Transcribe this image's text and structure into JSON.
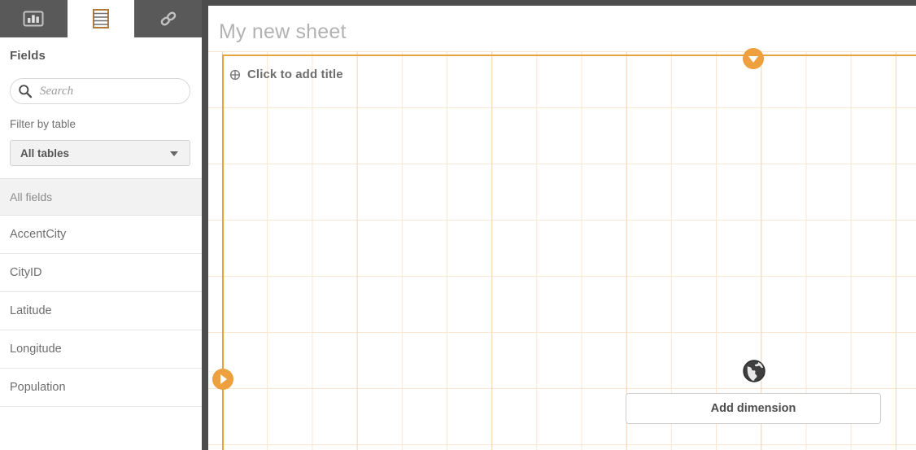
{
  "app": {
    "accent_color": "#ee9f3e",
    "grid_line_color": "#fbe6d0",
    "dark_bar_color": "#4d4d4d"
  },
  "sidebar": {
    "tabs": [
      {
        "name": "charts-tab",
        "icon": "bar-chart-icon",
        "active": false
      },
      {
        "name": "fields-tab",
        "icon": "table-icon",
        "active": true
      },
      {
        "name": "links-tab",
        "icon": "link-icon",
        "active": false
      }
    ],
    "panel_title": "Fields",
    "search": {
      "placeholder": "Search",
      "value": "",
      "icon": "search-icon"
    },
    "filter": {
      "label": "Filter by table",
      "selected": "All tables",
      "options": [
        "All tables"
      ]
    },
    "field_list": {
      "header": "All fields",
      "items": [
        {
          "label": "AccentCity"
        },
        {
          "label": "CityID"
        },
        {
          "label": "Latitude"
        },
        {
          "label": "Longitude"
        },
        {
          "label": "Population"
        }
      ]
    }
  },
  "sheet": {
    "title": "My new sheet",
    "object": {
      "add_title_label": "Click to add title",
      "add_title_icon": "crosshair-plus-icon",
      "visualization_icon": "globe-icon",
      "add_dimension_label": "Add dimension"
    },
    "handles": {
      "top": "collapse-down-handle",
      "left": "expand-right-handle"
    }
  }
}
